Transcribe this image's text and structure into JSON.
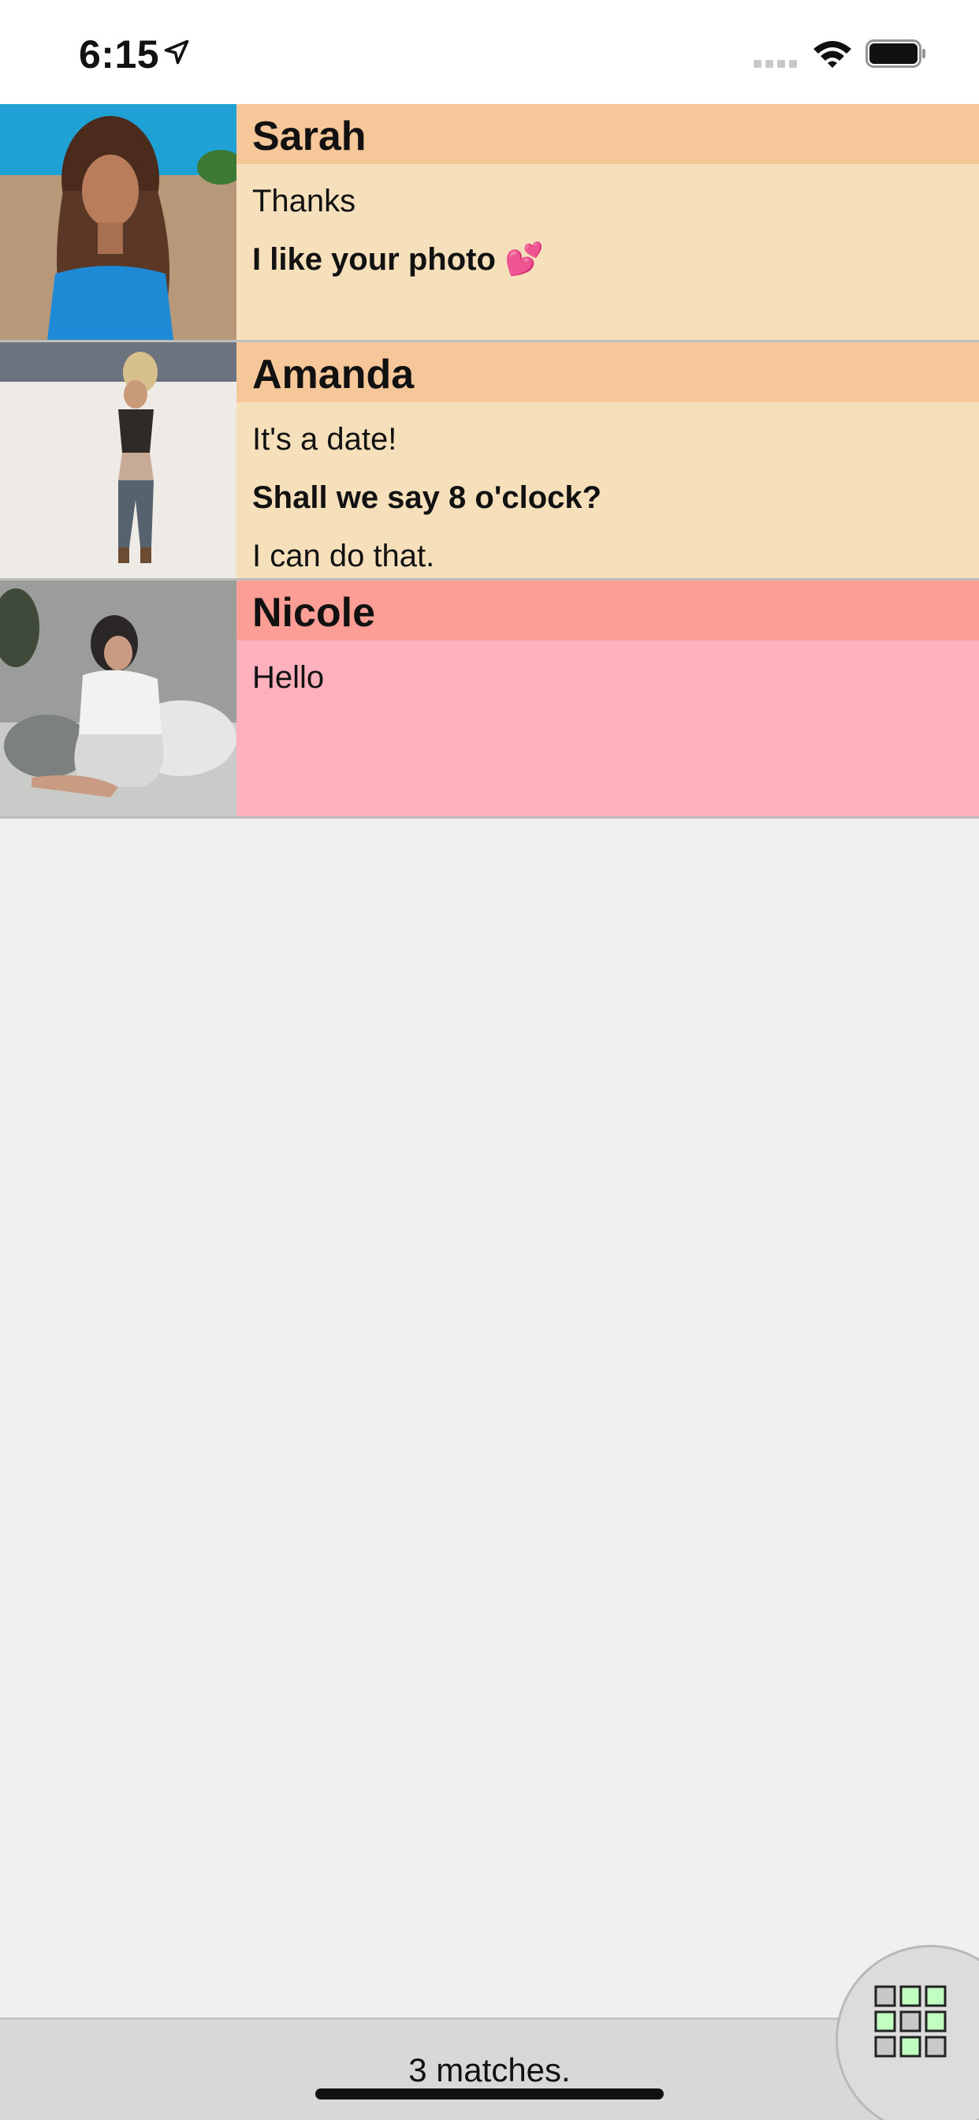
{
  "status_bar": {
    "time": "6:15",
    "icons": [
      "location-arrow-icon",
      "cellular-signal-icon",
      "wifi-icon",
      "battery-icon"
    ]
  },
  "matches": [
    {
      "name": "Sarah",
      "messages": [
        {
          "text": "Thanks",
          "bold": false
        },
        {
          "text": "I like your photo 💕",
          "bold": true
        }
      ]
    },
    {
      "name": "Amanda",
      "messages": [
        {
          "text": "It's a date!",
          "bold": false
        },
        {
          "text": "Shall we say 8 o'clock?",
          "bold": true
        },
        {
          "text": "I can do that.",
          "bold": false
        }
      ]
    },
    {
      "name": "Nicole",
      "messages": [
        {
          "text": "Hello",
          "bold": false
        }
      ]
    }
  ],
  "footer": {
    "match_count": "3 matches.",
    "grid_button_icon": "grid-icon"
  },
  "colors": {
    "sarah_header": "#f6c799",
    "sarah_body": "#f6e0bc",
    "amanda_header": "#f6c799",
    "amanda_body": "#f6e0bc",
    "nicole_header": "#fd9e96",
    "nicole_body": "#feb0bc",
    "background": "#f0f0f0"
  }
}
